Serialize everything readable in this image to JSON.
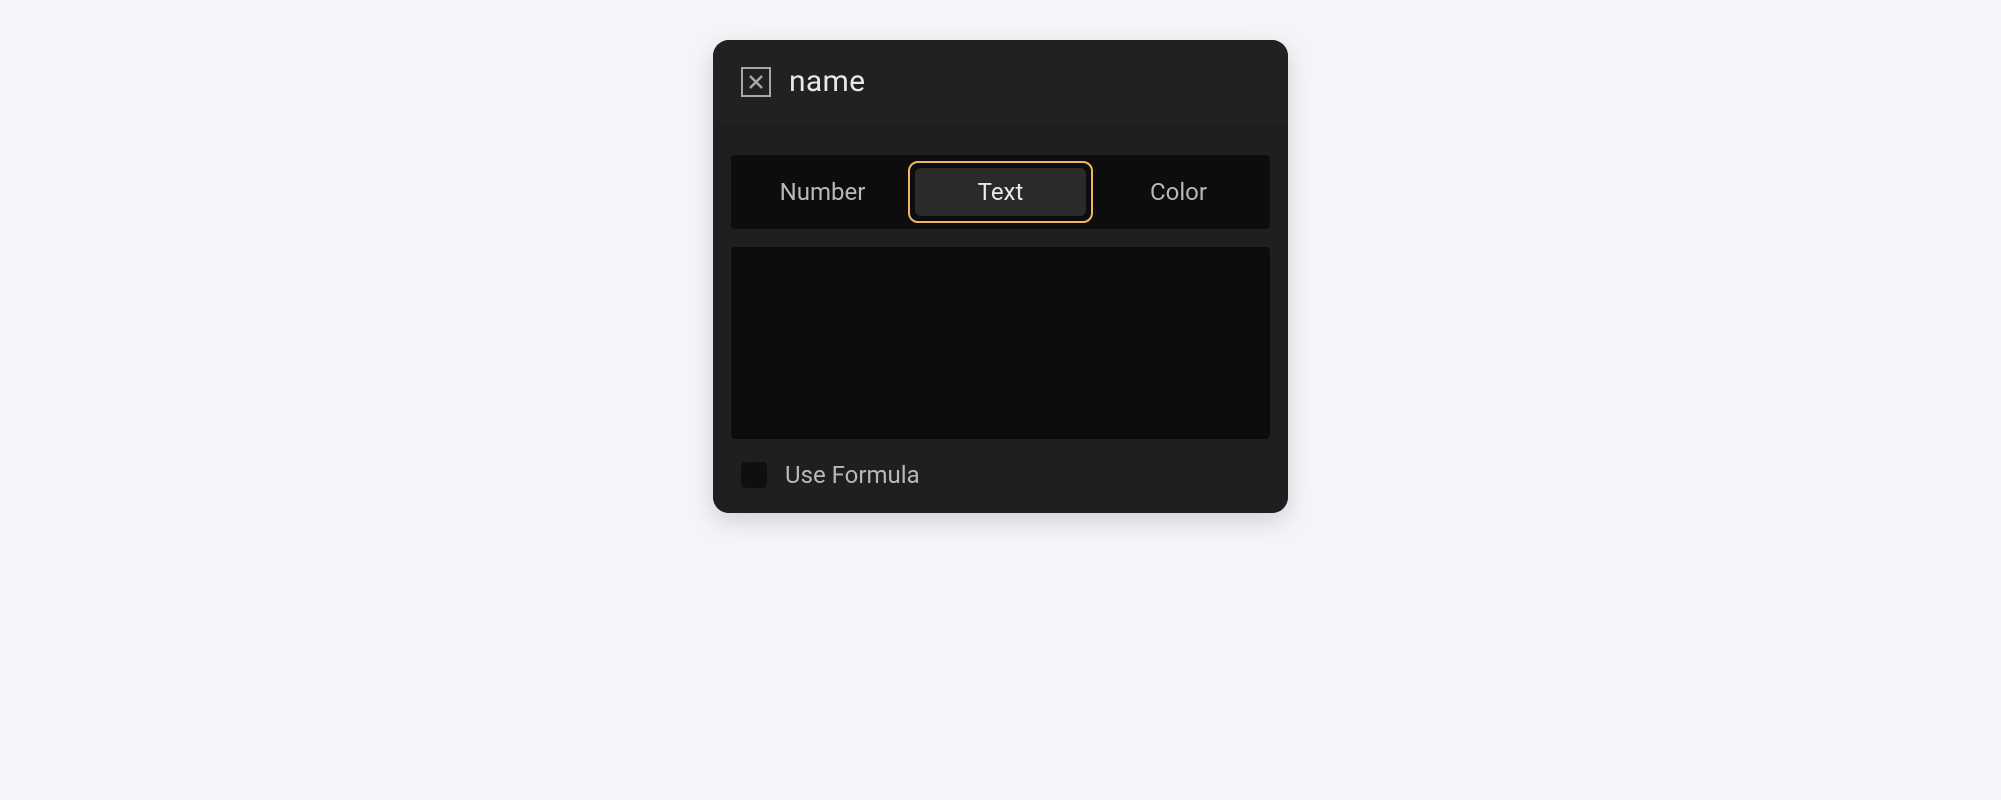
{
  "header": {
    "title": "name"
  },
  "tabs": {
    "items": [
      {
        "label": "Number"
      },
      {
        "label": "Text"
      },
      {
        "label": "Color"
      }
    ],
    "active_index": 1
  },
  "footer": {
    "use_formula_label": "Use Formula",
    "use_formula_checked": false
  }
}
